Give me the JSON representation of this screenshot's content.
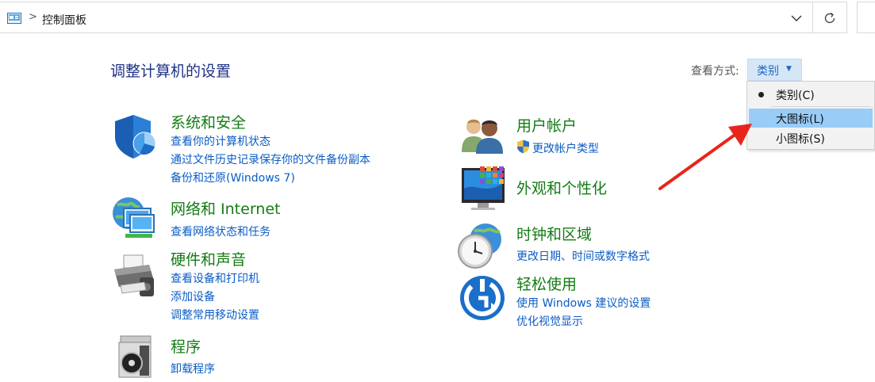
{
  "address_bar": {
    "path": [
      "控制面板"
    ],
    "separator": ">"
  },
  "page_title": "调整计算机的设置",
  "view_by": {
    "label": "查看方式:",
    "selected": "类别",
    "options": [
      "类别(C)",
      "大图标(L)",
      "小图标(S)"
    ],
    "checked_option": "类别(C)",
    "highlighted_option": "大图标(L)"
  },
  "categories": {
    "system_security": {
      "title": "系统和安全",
      "links": [
        "查看你的计算机状态",
        "通过文件历史记录保存你的文件备份副本",
        "备份和还原(Windows 7)"
      ]
    },
    "network": {
      "title": "网络和 Internet",
      "links": [
        "查看网络状态和任务"
      ]
    },
    "hardware": {
      "title": "硬件和声音",
      "links": [
        "查看设备和打印机",
        "添加设备",
        "调整常用移动设置"
      ]
    },
    "programs": {
      "title": "程序",
      "links": [
        "卸载程序"
      ]
    },
    "user_accounts": {
      "title": "用户帐户",
      "links": [
        "更改帐户类型"
      ]
    },
    "appearance": {
      "title": "外观和个性化",
      "links": []
    },
    "clock_region": {
      "title": "时钟和区域",
      "links": [
        "更改日期、时间或数字格式"
      ]
    },
    "ease_of_access": {
      "title": "轻松使用",
      "links": [
        "使用 Windows 建议的设置",
        "优化视觉显示"
      ]
    }
  },
  "colors": {
    "category_title": "#137c14",
    "link": "#0b5cc5",
    "page_title": "#1e3287",
    "menu_highlight": "#99ccf7",
    "annotation_arrow": "#e8251a"
  }
}
